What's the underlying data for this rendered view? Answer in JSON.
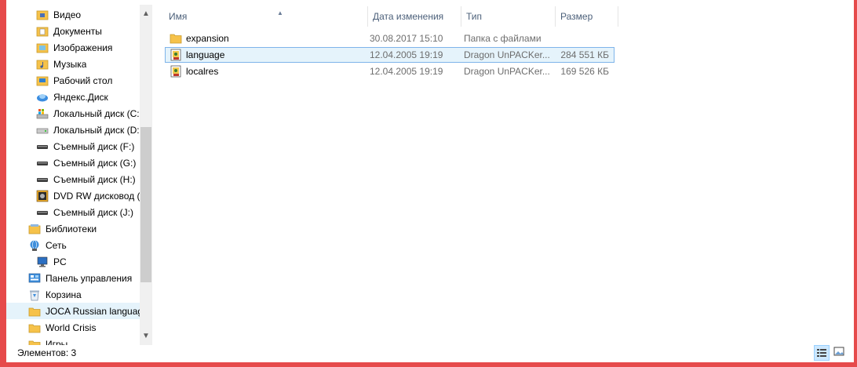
{
  "nav_pane": {
    "items": [
      {
        "label": "Видео",
        "icon": "video-folder-icon"
      },
      {
        "label": "Документы",
        "icon": "documents-folder-icon"
      },
      {
        "label": "Изображения",
        "icon": "pictures-folder-icon"
      },
      {
        "label": "Музыка",
        "icon": "music-folder-icon"
      },
      {
        "label": "Рабочий стол",
        "icon": "desktop-folder-icon"
      },
      {
        "label": "Яндекс.Диск",
        "icon": "yandex-disk-icon"
      },
      {
        "label": "Локальный диск (C:",
        "icon": "system-drive-icon"
      },
      {
        "label": "Локальный диск (D:",
        "icon": "local-drive-icon"
      },
      {
        "label": "Съемный диск (F:)",
        "icon": "removable-drive-icon"
      },
      {
        "label": "Съемный диск (G:)",
        "icon": "removable-drive-icon"
      },
      {
        "label": "Съемный диск (H:)",
        "icon": "removable-drive-icon"
      },
      {
        "label": "DVD RW дисковод (I",
        "icon": "dvd-drive-icon"
      },
      {
        "label": "Съемный диск (J:)",
        "icon": "removable-drive-icon"
      },
      {
        "label": "Библиотеки",
        "icon": "libraries-icon"
      },
      {
        "label": "Сеть",
        "icon": "network-icon"
      },
      {
        "label": "PC",
        "icon": "computer-icon"
      },
      {
        "label": "Панель управления",
        "icon": "control-panel-icon"
      },
      {
        "label": "Корзина",
        "icon": "recycle-bin-icon"
      },
      {
        "label": "JOCA Russian languag",
        "icon": "folder-icon"
      },
      {
        "label": "World Crisis",
        "icon": "folder-icon"
      },
      {
        "label": "Игры",
        "icon": "folder-icon"
      }
    ]
  },
  "columns": {
    "name": "Имя",
    "date": "Дата изменения",
    "type": "Тип",
    "size": "Размер"
  },
  "files": [
    {
      "name": "expansion",
      "date": "30.08.2017 15:10",
      "type": "Папка с файлами",
      "size": "",
      "icon": "folder-icon"
    },
    {
      "name": "language",
      "date": "12.04.2005 19:19",
      "type": "Dragon UnPACKer...",
      "size": "284 551 КБ",
      "icon": "archive-file-icon"
    },
    {
      "name": "localres",
      "date": "12.04.2005 19:19",
      "type": "Dragon UnPACKer...",
      "size": "169 526 КБ",
      "icon": "archive-file-icon"
    }
  ],
  "status": {
    "items_count": "Элементов: 3"
  },
  "colors": {
    "frame": "#e64a4b",
    "selection_bg": "#e5f3fb",
    "selection_border": "#7eb4ea",
    "header_text": "#4c607a",
    "muted_text": "#6d6d6d"
  }
}
